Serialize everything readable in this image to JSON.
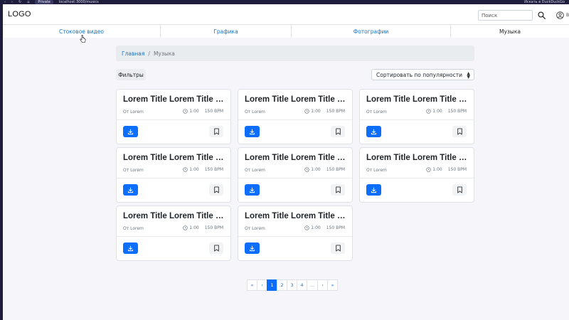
{
  "browser": {
    "private_label": "Private",
    "url": "localhost:3000/musics",
    "search_engine_label": "Искать в DuckDuckGo"
  },
  "header": {
    "logo": "LOGO",
    "search_placeholder": "Поиск",
    "user_label": "В"
  },
  "tabs": [
    {
      "label": "Стоковое видео",
      "active": false
    },
    {
      "label": "Графика",
      "active": false
    },
    {
      "label": "Фотографии",
      "active": false
    },
    {
      "label": "Музыка",
      "active": true
    }
  ],
  "breadcrumb": {
    "home": "Главная",
    "separator": "/",
    "current": "Музыка"
  },
  "toolbar": {
    "filters_label": "Фильтры",
    "sort_label": "Сортировать по популярности"
  },
  "cards": [
    {
      "title": "Lorem Title Lorem Title Lorem Title",
      "author": "От Lorem",
      "duration": "1:00",
      "bpm": "150 BPM"
    },
    {
      "title": "Lorem Title Lorem Title Lorem Title",
      "author": "От Lorem",
      "duration": "1:00",
      "bpm": "150 BPM"
    },
    {
      "title": "Lorem Title Lorem Title Lorem Title",
      "author": "От Lorem",
      "duration": "1:00",
      "bpm": "150 BPM"
    },
    {
      "title": "Lorem Title Lorem Title Lorem Title",
      "author": "От Lorem",
      "duration": "1:00",
      "bpm": "150 BPM"
    },
    {
      "title": "Lorem Title Lorem Title Lorem Title",
      "author": "От Lorem",
      "duration": "1:00",
      "bpm": "150 BPM"
    },
    {
      "title": "Lorem Title Lorem Title Lorem Title",
      "author": "От Lorem",
      "duration": "1:00",
      "bpm": "150 BPM"
    },
    {
      "title": "Lorem Title Lorem Title Lorem Title",
      "author": "От Lorem",
      "duration": "1:00",
      "bpm": "150 BPM"
    },
    {
      "title": "Lorem Title Lorem Title Lorem Title",
      "author": "От Lorem",
      "duration": "1:00",
      "bpm": "150 BPM"
    }
  ],
  "pagination": {
    "first": "«",
    "prev": "‹",
    "pages": [
      "1",
      "2",
      "3",
      "4"
    ],
    "ellipsis": "...",
    "next": "›",
    "last": "»",
    "current": "1"
  },
  "colors": {
    "primary": "#0d6efd",
    "link": "#1a73c8",
    "page_bg": "#f5f5fa",
    "browser_chrome": "#1f1d3d"
  }
}
